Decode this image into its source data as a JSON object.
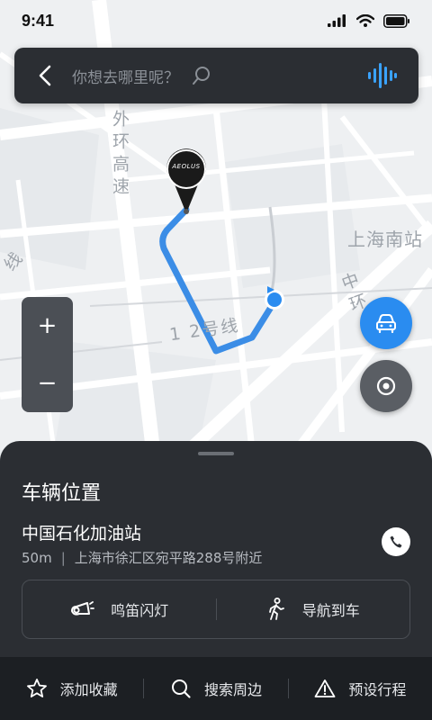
{
  "status_bar": {
    "time": "9:41"
  },
  "search": {
    "placeholder": "你想去哪里呢？"
  },
  "map": {
    "labels": {
      "outer_ring": "外环高速",
      "station": "上海南站",
      "metro": "1 2号线",
      "middle_ring": "中环",
      "line_left": "线"
    }
  },
  "marker": {
    "logo_text": "AEOLUS"
  },
  "zoom": {
    "in": "+",
    "out": "−"
  },
  "sheet": {
    "title": "车辆位置",
    "place_name": "中国石化加油站",
    "distance": "50m",
    "separator": "|",
    "address": "上海市徐汇区宛平路288号附近",
    "actions": [
      {
        "label": "鸣笛闪灯",
        "icon": "horn-icon"
      },
      {
        "label": "导航到车",
        "icon": "walking-icon"
      }
    ]
  },
  "tabbar": {
    "items": [
      {
        "label": "添加收藏",
        "icon": "star-icon"
      },
      {
        "label": "搜索周边",
        "icon": "search-icon"
      },
      {
        "label": "预设行程",
        "icon": "warning-icon"
      }
    ]
  },
  "colors": {
    "accent": "#2a8cf0",
    "panel": "#2b2e33",
    "tabbar": "#1c1f23"
  }
}
